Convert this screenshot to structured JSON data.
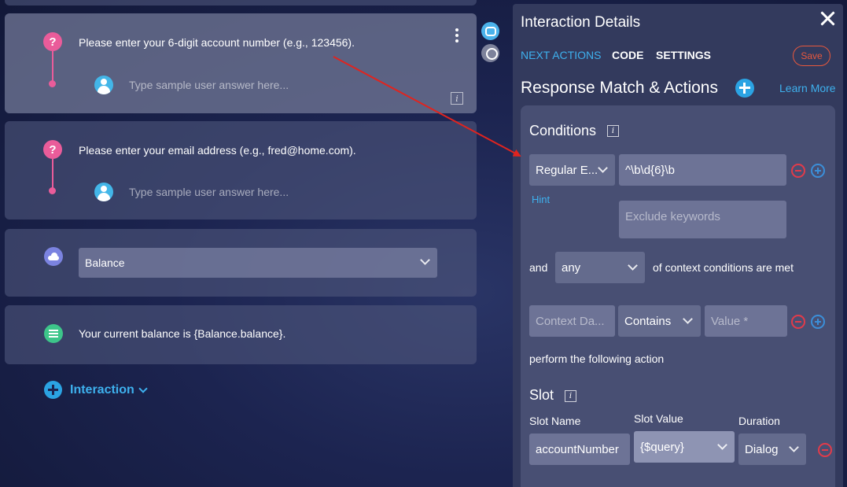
{
  "flow": {
    "card1": {
      "prompt": "Please enter your 6-digit account number (e.g., 123456).",
      "sample_placeholder": "Type sample user answer here...",
      "info": "i"
    },
    "card2": {
      "prompt": "Please enter your email address (e.g., fred@home.com).",
      "sample_placeholder": "Type sample user answer here..."
    },
    "card3": {
      "selected_value": "Balance"
    },
    "card4": {
      "message": "Your current balance is {Balance.balance}."
    },
    "add_interaction_label": "Interaction",
    "question_icon_glyph": "?"
  },
  "panel": {
    "title": "Interaction Details",
    "tabs": [
      {
        "label": "NEXT ACTIONS"
      },
      {
        "label": "CODE"
      },
      {
        "label": "SETTINGS"
      }
    ],
    "save_label": "Save",
    "section_title": "Response Match & Actions",
    "learn_more": "Learn More",
    "conditions": {
      "title": "Conditions",
      "info": "i",
      "match_type": "Regular E...",
      "pattern": "^\\b\\d{6}\\b",
      "hint": "Hint",
      "exclude_placeholder": "Exclude keywords",
      "and_label": "and",
      "any_value": "any",
      "context_suffix": "of context conditions are met",
      "context_data_placeholder": "Context Da...",
      "operator": "Contains",
      "value_placeholder": "Value *",
      "perform_label": "perform the following action"
    },
    "slot": {
      "title": "Slot",
      "info": "i",
      "name_header": "Slot Name",
      "value_header": "Slot Value",
      "duration_header": "Duration",
      "name": "accountNumber",
      "value": "{$query}",
      "duration": "Dialog"
    }
  },
  "colors": {
    "accent_blue": "#3eb1ee",
    "danger_red": "#e23b4a",
    "save_orange": "#e8583d",
    "question_pink": "#ea5c9a",
    "annotation_arrow": "#e0241f"
  },
  "icons": [
    "question-icon",
    "user-icon",
    "cloud-icon",
    "list-icon",
    "kebab-menu-icon",
    "info-icon",
    "close-icon",
    "plus-icon",
    "minus-icon",
    "chevron-down-icon",
    "chat-bubble-icon",
    "support-icon"
  ]
}
